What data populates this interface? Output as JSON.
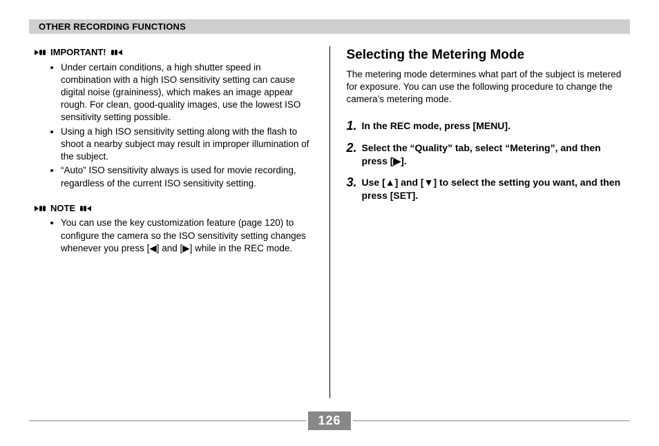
{
  "header": "OTHER RECORDING FUNCTIONS",
  "left_column": {
    "important_label": "IMPORTANT!",
    "important_items": [
      "Under certain conditions, a high shutter speed in combination with a high ISO sensitivity setting can cause digital noise (graininess), which makes an image appear rough. For clean, good-quality images, use the lowest ISO sensitivity setting possible.",
      "Using a high ISO sensitivity setting along with the flash to shoot a nearby subject may result in improper illumination of the subject.",
      "“Auto” ISO sensitivity always is used for movie recording, regardless of the current ISO sensitivity setting."
    ],
    "note_label": "NOTE",
    "note_items": [
      "You can use the key customization feature (page 120) to configure the camera so the ISO sensitivity setting changes whenever you press [◀] and [▶] while in the REC mode."
    ]
  },
  "right_column": {
    "heading": "Selecting the Metering Mode",
    "intro": "The metering mode determines what part of the subject is metered for exposure. You can use the following procedure to change the camera’s metering mode.",
    "steps": [
      {
        "n": "1.",
        "text": "In the REC mode, press [MENU]."
      },
      {
        "n": "2.",
        "text": "Select the “Quality” tab, select “Metering”, and then press [▶]."
      },
      {
        "n": "3.",
        "text": "Use [▲] and [▼] to select the setting you want, and then press [SET]."
      }
    ]
  },
  "page_number": "126"
}
